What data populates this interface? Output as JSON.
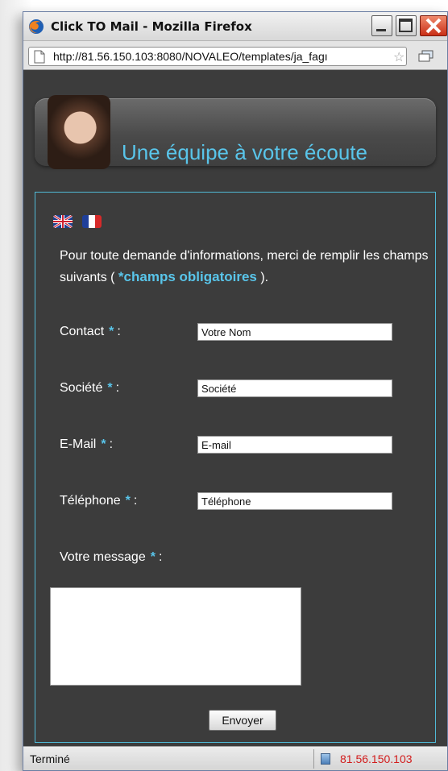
{
  "window": {
    "title": "Click TO Mail - Mozilla Firefox",
    "url": "http://81.56.150.103:8080/NOVALEO/templates/ja_fagı"
  },
  "banner": {
    "title": "Une équipe à votre écoute"
  },
  "form": {
    "intro_text": "Pour toute demande d'informations, merci de remplir les champs suivants (",
    "required_note": "*champs obligatoires",
    "intro_end": ").",
    "fields": [
      {
        "label": "Contact",
        "value": "Votre Nom"
      },
      {
        "label": "Société",
        "value": "Société"
      },
      {
        "label": "E-Mail",
        "value": "E-mail"
      },
      {
        "label": "Téléphone",
        "value": "Téléphone"
      }
    ],
    "message_label": "Votre message",
    "star": "*",
    "colon": ":",
    "submit_label": "Envoyer"
  },
  "status": {
    "text": "Terminé",
    "ip": "81.56.150.103"
  },
  "colors": {
    "accent": "#59c5ea",
    "background": "#3c3c3c",
    "status_ip": "#d21c1c"
  },
  "icons": [
    "firefox-icon",
    "page-icon",
    "bookmark-star-icon",
    "uk-flag-icon",
    "france-flag-icon"
  ]
}
